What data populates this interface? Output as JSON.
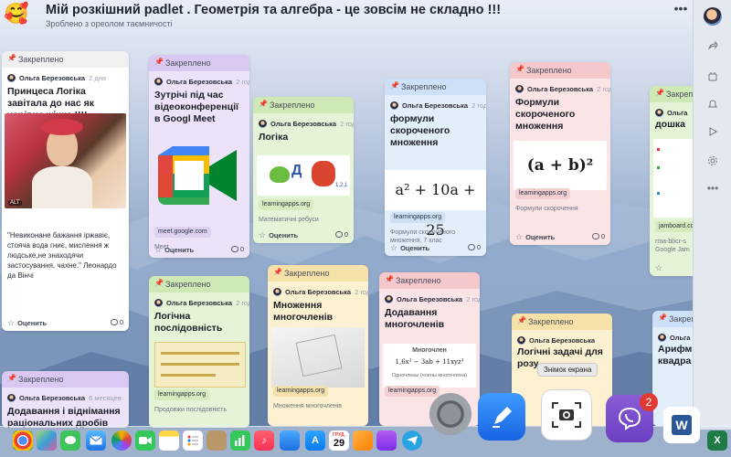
{
  "header": {
    "emoji": "🥰",
    "title": "Мій розкішний padlet . Геометрія та алгебра - це зовсім не складно !!!",
    "subtitle": "Зроблено з ореолом таємничості",
    "more": "•••"
  },
  "toolbar": {
    "icons": [
      "user-avatar",
      "share-icon",
      "remake-icon",
      "bell-icon",
      "play-icon",
      "gear-icon",
      "more-icon"
    ],
    "more": "•••"
  },
  "common": {
    "pinned": "Закреплено",
    "author": "Ольга Березовська",
    "rate": "Оценить",
    "zero": "0"
  },
  "cards": {
    "princess": {
      "time": "2 дня",
      "title": "Принцеса Логіка завітала до нас як чарівна жінка !!!!",
      "alt": "ALT",
      "quote": "\"Невиконане бажання іржавіє, стояча вода гниє, мислення ж людське,не знаходячи застосування, чахне.\" Леонардо да Вінчі"
    },
    "meet": {
      "time": "2 года",
      "title": "Зутрічі під час відеоконференції в Googl Meet",
      "link": "meet.google.com",
      "caption": "Meet"
    },
    "logic": {
      "time": "2 года",
      "title": "Логіка",
      "link": "learningapps.org",
      "caption": "Математичні ребуси",
      "rebus_letter": "Д",
      "rebus_digits": "1,2,1"
    },
    "formulas_blue": {
      "time": "2 года",
      "title": "формули скороченого множення",
      "formula": "a² + 10a + 25",
      "link": "learningapps.org",
      "caption": "Формули скороченого множення, 7 клас"
    },
    "formulas_pink": {
      "time": "2 года",
      "title": "Формули скороченого множення",
      "formula": "(a + b)²",
      "link": "learningapps.org",
      "caption": "Формули скорочення"
    },
    "edge_green": {
      "pinned": "Закреп",
      "author": "Ольга",
      "title": "дошка",
      "link": "jamboard.co",
      "caption": "rma-bbcr-s Google Jam"
    },
    "sequence": {
      "time": "2 года",
      "title": "Логічна послідовність",
      "link": "learningapps.org",
      "caption": "Продовжи послідовність"
    },
    "polynomials": {
      "time": "2 года",
      "title": "Множення многочленів",
      "link": "learningapps.org",
      "caption": "Множення многочленів"
    },
    "adding_pink": {
      "time": "2 года",
      "title": "Додавання многочленів",
      "image_title": "Многочлен",
      "image_formula": "1,6x² − 3ab + 11xyz³",
      "image_caption": "Одночлены (члены многочлена)",
      "link": "learningapps.org"
    },
    "tasks_yellow": {
      "title": "Логічні задачі для розу",
      "tooltip": "Знімок екрана"
    },
    "arith_blue": {
      "pinned": "Закреп",
      "author": "Ольга",
      "title": "Арифм квадра"
    },
    "bottom_left": {
      "time": "6 месяцев",
      "title": "Додавання і віднімання раціональних дробів"
    }
  },
  "dock": {
    "calendar_month": "ГРУД.",
    "calendar_day": "29",
    "viber_badge": "2",
    "word_letter": "W",
    "excel_letter": "X"
  }
}
